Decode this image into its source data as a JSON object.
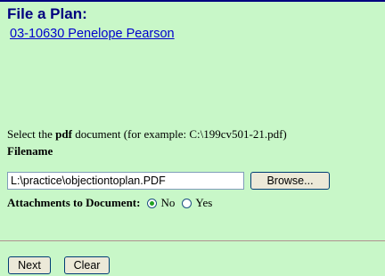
{
  "page": {
    "title": "File a Plan:",
    "case_link": "03-10630 Penelope Pearson"
  },
  "form": {
    "instruction_prefix": "Select the ",
    "instruction_bold": "pdf",
    "instruction_suffix": " document (for example: C:\\199cv501-21.pdf)",
    "filename_label": "Filename",
    "filename_value": "L:\\practice\\objectiontoplan.PDF",
    "browse_label": "Browse...",
    "attachments_label": "Attachments to Document:",
    "attachments_options": [
      {
        "label": "No",
        "selected": true
      },
      {
        "label": "Yes",
        "selected": false
      }
    ]
  },
  "actions": {
    "next_label": "Next",
    "clear_label": "Clear"
  },
  "colors": {
    "background": "#c8f7c8",
    "title": "#000080",
    "link": "#0000cc"
  }
}
